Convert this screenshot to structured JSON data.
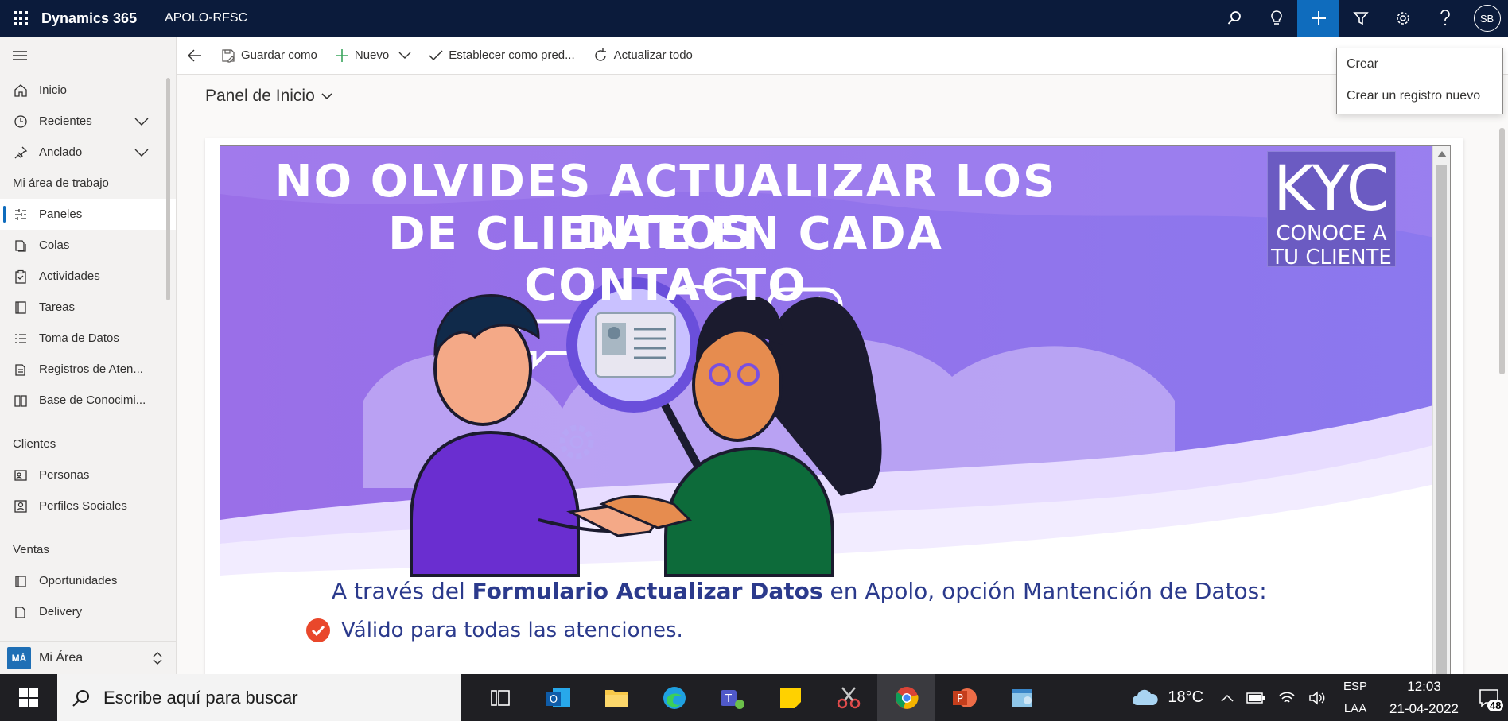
{
  "topbar": {
    "app_name": "Dynamics 365",
    "environment": "APOLO-RFSC",
    "user_initials": "SB"
  },
  "sidebar": {
    "items": [
      {
        "label": "Inicio"
      },
      {
        "label": "Recientes"
      },
      {
        "label": "Anclado"
      }
    ],
    "workspace_header": "Mi área de trabajo",
    "workspace_items": [
      {
        "label": "Paneles"
      },
      {
        "label": "Colas"
      },
      {
        "label": "Actividades"
      },
      {
        "label": "Tareas"
      },
      {
        "label": "Toma de Datos"
      },
      {
        "label": "Registros de Aten..."
      },
      {
        "label": "Base de Conocimi..."
      }
    ],
    "clientes_header": "Clientes",
    "clientes_items": [
      {
        "label": "Personas"
      },
      {
        "label": "Perfiles Sociales"
      }
    ],
    "ventas_header": "Ventas",
    "ventas_items": [
      {
        "label": "Oportunidades"
      },
      {
        "label": "Delivery"
      }
    ],
    "area_badge": "MÁ",
    "area_label": "Mi Área"
  },
  "commandbar": {
    "save_as": "Guardar como",
    "new": "Nuevo",
    "set_default": "Establecer como pred...",
    "refresh_all": "Actualizar todo"
  },
  "flyout": {
    "items": [
      {
        "label": "Crear"
      },
      {
        "label": "Crear un registro nuevo"
      }
    ]
  },
  "panel": {
    "title": "Panel de Inicio"
  },
  "banner": {
    "headline_1": "NO OLVIDES ACTUALIZAR LOS DATOS",
    "headline_2": "DE CLIENTE EN CADA CONTACTO",
    "kyc_big": "KYC",
    "kyc_line1": "CONOCE A",
    "kyc_line2": "TU CLIENTE",
    "lead_prefix": "A través del ",
    "lead_bold": "Formulario Actualizar Datos",
    "lead_suffix": " en Apolo, opción Mantención de Datos:",
    "check_1": "Válido para todas las atenciones."
  },
  "taskbar": {
    "search_placeholder": "Escribe aquí para buscar",
    "temperature": "18°C",
    "lang_1": "ESP",
    "lang_2": "LAA",
    "time": "12:03",
    "date": "21-04-2022",
    "notifications": "48"
  },
  "colors": {
    "topbar": "#0b1b3b",
    "accent": "#0f6cbd",
    "banner_purple": "#8b6ff0"
  }
}
